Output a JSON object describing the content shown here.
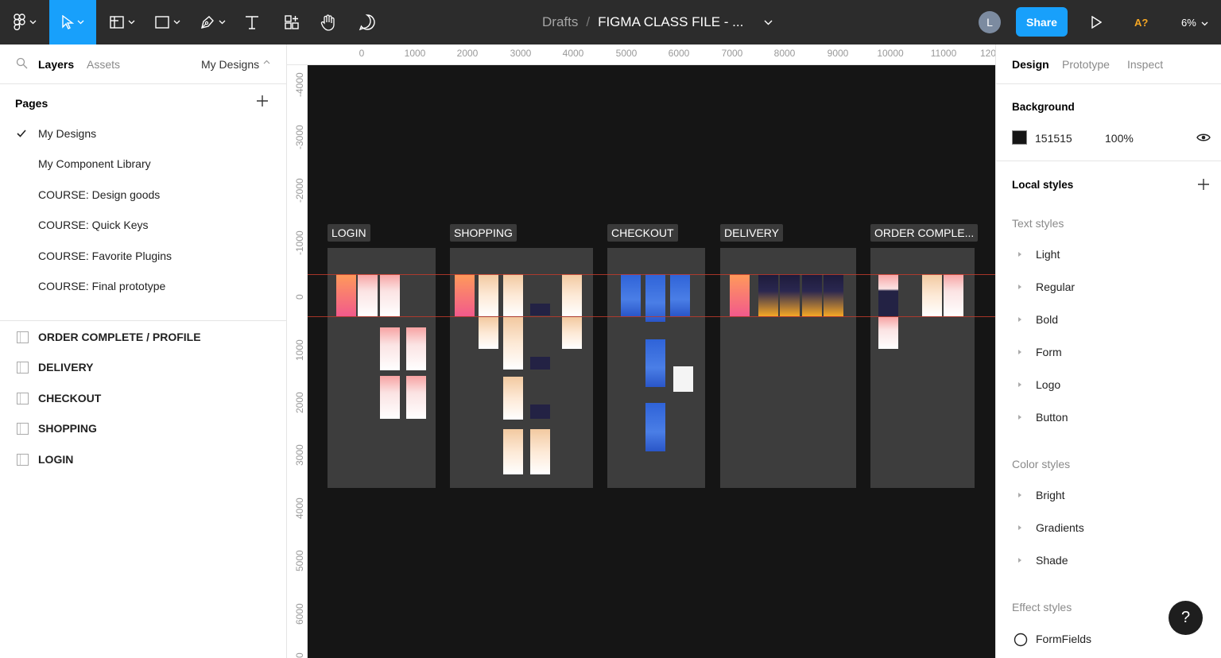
{
  "toolbar": {
    "breadcrumb_drafts": "Drafts",
    "breadcrumb_sep": "/",
    "file_name": "FIGMA CLASS FILE - ...",
    "avatar_initial": "L",
    "share_label": "Share",
    "accessibility_label": "A?",
    "zoom_label": "6%"
  },
  "left_panel": {
    "tab_layers": "Layers",
    "tab_assets": "Assets",
    "page_selector": "My Designs",
    "pages_heading": "Pages",
    "pages": [
      "My Designs",
      "My Component Library",
      "COURSE: Design goods",
      "COURSE: Quick Keys",
      "COURSE: Favorite Plugins",
      "COURSE: Final prototype"
    ],
    "layers": [
      "ORDER COMPLETE / PROFILE",
      "DELIVERY",
      "CHECKOUT",
      "SHOPPING",
      "LOGIN"
    ]
  },
  "ruler": {
    "top": [
      "0",
      "1000",
      "2000",
      "3000",
      "4000",
      "5000",
      "6000",
      "7000",
      "8000",
      "9000",
      "10000",
      "11000",
      "120"
    ],
    "left": [
      "-4000",
      "-3000",
      "-2000",
      "-1000",
      "0",
      "1000",
      "2000",
      "3000",
      "4000",
      "5000",
      "6000",
      "0"
    ]
  },
  "canvas": {
    "frames": [
      "LOGIN",
      "SHOPPING",
      "CHECKOUT",
      "DELIVERY",
      "ORDER COMPLE..."
    ]
  },
  "right_panel": {
    "tab_design": "Design",
    "tab_prototype": "Prototype",
    "tab_inspect": "Inspect",
    "background_heading": "Background",
    "bg_hex": "151515",
    "bg_opacity": "100%",
    "local_styles_heading": "Local styles",
    "text_styles_heading": "Text styles",
    "text_styles": [
      "Light",
      "Regular",
      "Bold",
      "Form",
      "Logo",
      "Button"
    ],
    "color_styles_heading": "Color styles",
    "color_styles": [
      "Bright",
      "Gradients",
      "Shade"
    ],
    "effect_styles_heading": "Effect styles",
    "effect_styles": [
      "FormFields"
    ]
  },
  "help_label": "?",
  "colors": {
    "toolbar_bg": "#2c2c2c",
    "accent": "#18a0fb",
    "canvas_bg": "#151515",
    "frame_bg": "#3d3d3d",
    "guide": "#c0392b"
  }
}
